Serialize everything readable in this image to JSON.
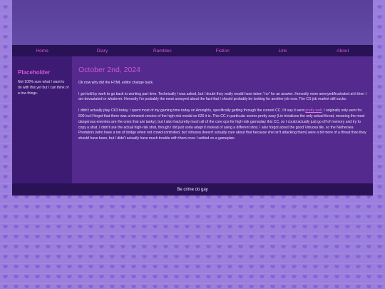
{
  "nav": {
    "items": [
      "Home",
      "Diary",
      "Rambles",
      "Fiction",
      "Link",
      "About"
    ]
  },
  "sidebar": {
    "title": "Placeholder",
    "text": "Not 100% sure what I want to do with this yet but I can think of a few things."
  },
  "post": {
    "date": "October 2nd, 2024",
    "p1": "Ok now why did the HTML editor change back.",
    "p2": "I got told by work to go back to working part time. Technically I was asked, but I doubt they really would have taken \"no\" for an answer. Honestly more annoyed/frustrated at it then I am devastated or whatever. Honestly I'm probably the most annoyed about the fact that I should probably be looking for another job now. The CS job market still sucks.",
    "p3_before": "I didn't actually play CK3 today. I spent most of my gaming time today on Arknights, specifically getting through the current CC. I'd say it went ",
    "p3_link": "pretty well",
    "p3_after": ". I originally only went for 600 but I forgot that there was a trimmed version of the high-risk medal so 620 it is. This CC in particular seems pretty easy (Lin trivializes the only actual threat, meaning the most dangerous enemies are the ones that are tanky), but I also had pretty much all of the core ops for high-risk gameplay this CC, so I could actually just go off of memory and try to copy a strat. I didn't use the actual high-risk strat, though I did just sorta adapt it instead of using a different strat. I also forgot about the good Virtuosa tile, so the Nethersea Predators (who have a ton of dodge when not crowd-controlled, but Virtuosa doesn't actually care about that because she isn't attacking them) were a bit more of a threat than they should have been, but I didn't actually have much trouble with them once I settled on a gameplan."
  },
  "footer": {
    "text": "Be crime do gay"
  },
  "colors": {
    "accent": "#d155d6",
    "nav_bg": "#2a1257",
    "main_bg": "#542a8f",
    "sidebar_bg": "#3d1b73",
    "page_bg": "#c2a8ee"
  }
}
